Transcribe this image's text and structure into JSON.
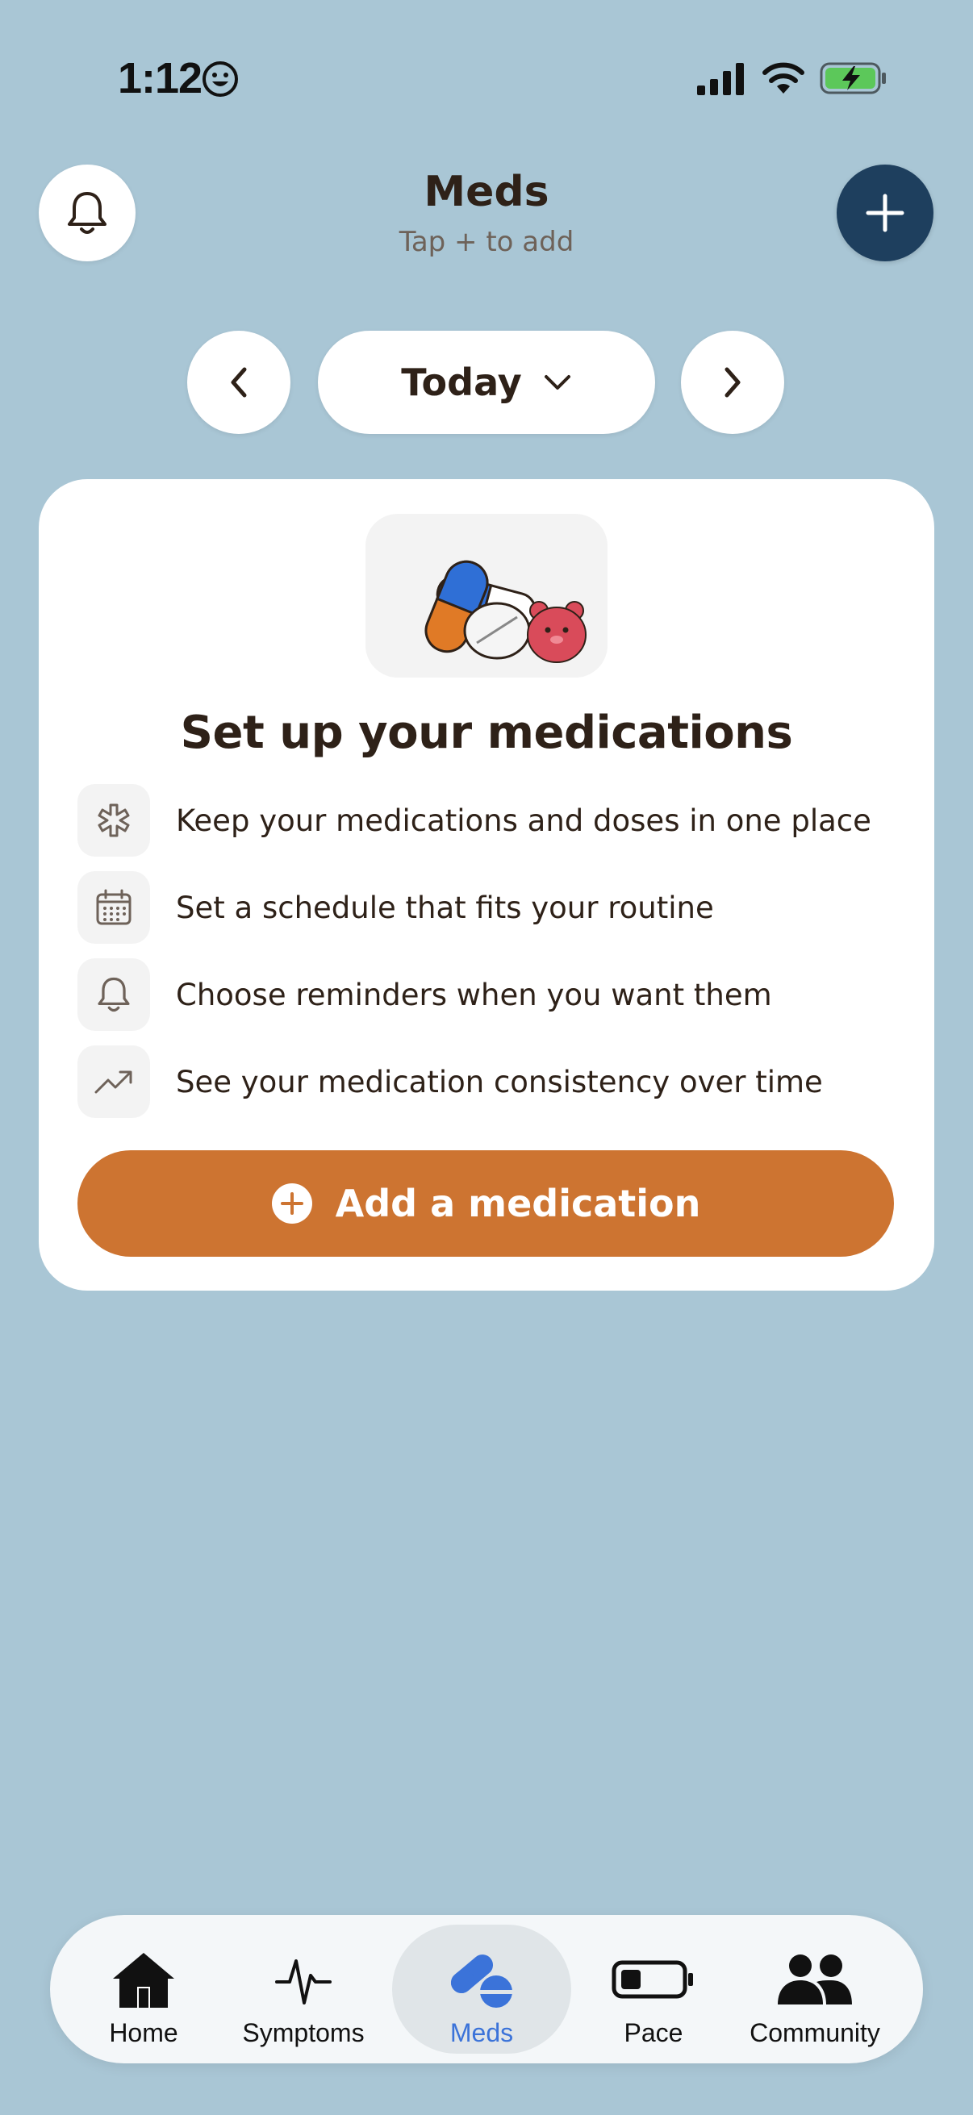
{
  "status_bar": {
    "time": "1:12",
    "icons": [
      "smiley-icon",
      "cellular-signal-icon",
      "wifi-icon",
      "battery-charging-icon"
    ]
  },
  "header": {
    "title": "Meds",
    "subtitle": "Tap + to add",
    "bell_icon": "bell-icon",
    "add_icon": "plus-icon"
  },
  "date_nav": {
    "label": "Today",
    "prev_icon": "chevron-left-icon",
    "next_icon": "chevron-right-icon",
    "dropdown_icon": "chevron-down-icon"
  },
  "setup_card": {
    "title": "Set up your medications",
    "features": [
      {
        "icon": "medical-asterisk-icon",
        "text": "Keep your medications and doses in one place"
      },
      {
        "icon": "calendar-icon",
        "text": "Set a schedule that fits your routine"
      },
      {
        "icon": "bell-icon",
        "text": "Choose reminders when you want them"
      },
      {
        "icon": "trend-up-icon",
        "text": "See your medication consistency over time"
      }
    ],
    "button_label": "Add a medication"
  },
  "tab_bar": {
    "active": "Meds",
    "items": [
      {
        "label": "Home",
        "icon": "house-icon"
      },
      {
        "label": "Symptoms",
        "icon": "heartbeat-icon"
      },
      {
        "label": "Meds",
        "icon": "pills-icon"
      },
      {
        "label": "Pace",
        "icon": "battery-low-icon"
      },
      {
        "label": "Community",
        "icon": "people-icon"
      }
    ]
  },
  "colors": {
    "background": "#a9c6d5",
    "accent": "#cd7431",
    "fab": "#1e3f5e",
    "active_tab": "#3b73d9"
  }
}
